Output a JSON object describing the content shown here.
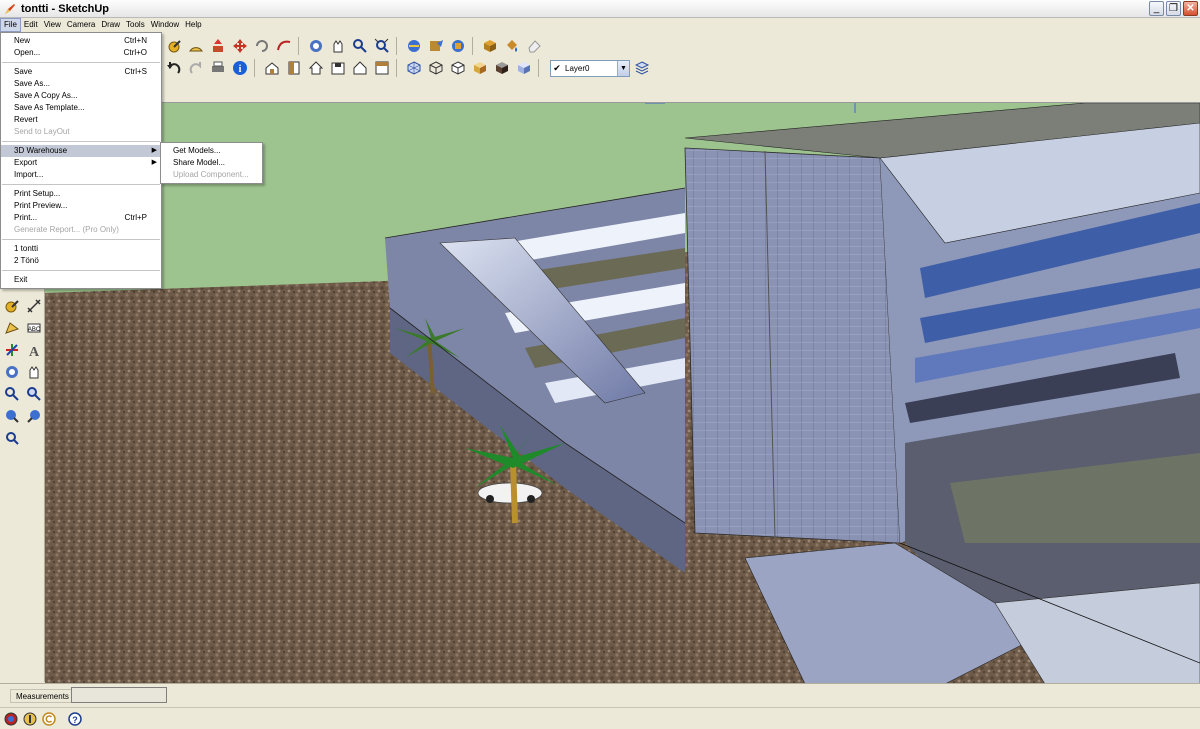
{
  "window": {
    "title": "tontti - SketchUp"
  },
  "menubar": [
    "File",
    "Edit",
    "View",
    "Camera",
    "Draw",
    "Tools",
    "Window",
    "Help"
  ],
  "file_menu": [
    {
      "label": "New",
      "shortcut": "Ctrl+N"
    },
    {
      "label": "Open...",
      "shortcut": "Ctrl+O"
    },
    {
      "sep": true
    },
    {
      "label": "Save",
      "shortcut": "Ctrl+S"
    },
    {
      "label": "Save As..."
    },
    {
      "label": "Save A Copy As..."
    },
    {
      "label": "Save As Template..."
    },
    {
      "label": "Revert"
    },
    {
      "label": "Send to LayOut",
      "disabled": true
    },
    {
      "sep": true
    },
    {
      "label": "3D Warehouse",
      "submenu": true,
      "highlight": true
    },
    {
      "label": "Export",
      "submenu": true
    },
    {
      "label": "Import..."
    },
    {
      "sep": true
    },
    {
      "label": "Print Setup..."
    },
    {
      "label": "Print Preview..."
    },
    {
      "label": "Print...",
      "shortcut": "Ctrl+P"
    },
    {
      "label": "Generate Report... (Pro Only)",
      "disabled": true
    },
    {
      "sep": true
    },
    {
      "label": "1 tontti"
    },
    {
      "label": "2 Tönö"
    },
    {
      "sep": true
    },
    {
      "label": "Exit"
    }
  ],
  "warehouse_submenu": [
    {
      "label": "Get Models..."
    },
    {
      "label": "Share Model..."
    },
    {
      "label": "Upload Component...",
      "disabled": true
    }
  ],
  "layers": {
    "current": "Layer0"
  },
  "measurements": {
    "label": "Measurements",
    "value": ""
  },
  "colors": {
    "sky": "#9dc38f",
    "ground": "#6e5a48",
    "menu_highlight": "#c2c8d6"
  }
}
